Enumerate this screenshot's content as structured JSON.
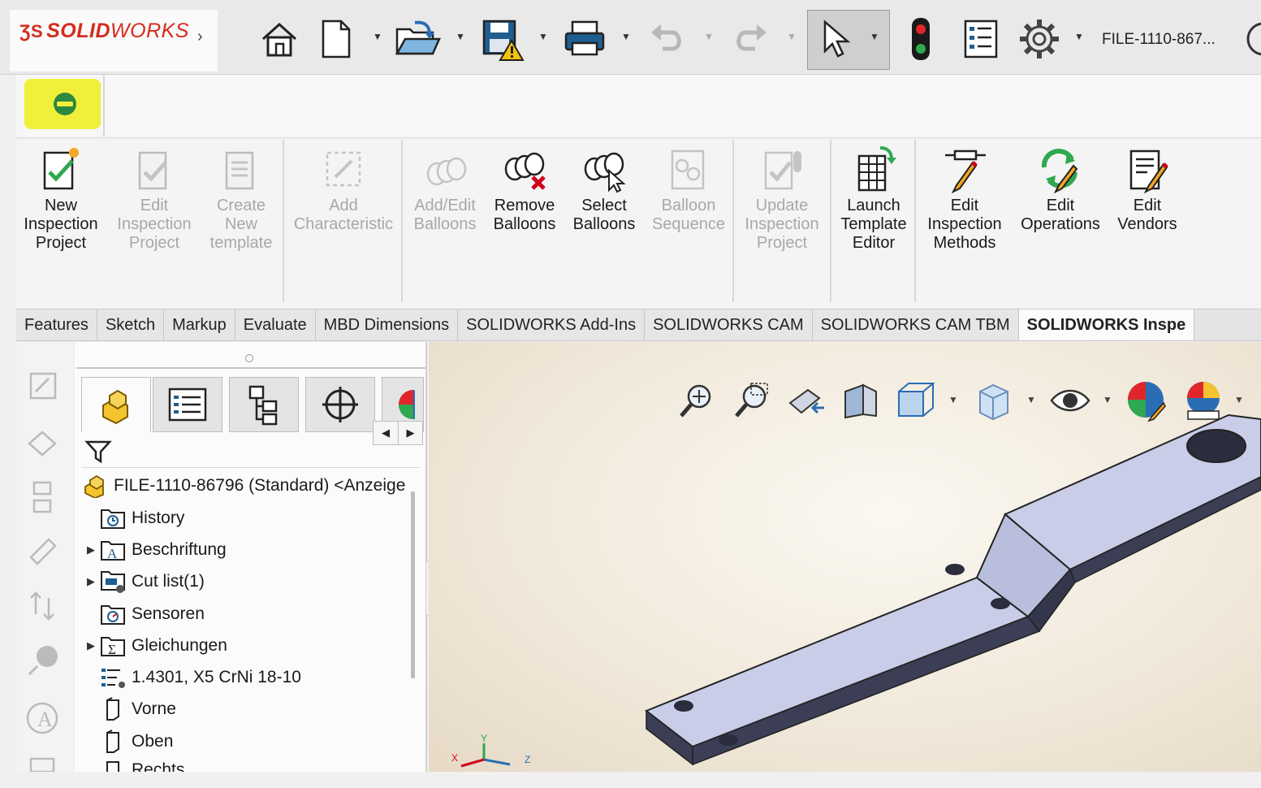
{
  "app": {
    "brand_prefix": "SOLID",
    "brand_suffix": "WORKS",
    "file_title": "FILE-1110-867..."
  },
  "top_toolbar": {
    "icons": [
      "home-icon",
      "new-document-icon",
      "open-icon",
      "save-warning-icon",
      "print-icon",
      "undo-icon",
      "redo-icon",
      "select-pointer-icon",
      "rebuild-traffic-light-icon",
      "file-properties-icon",
      "options-gear-icon",
      "user-icon"
    ]
  },
  "ribbon": {
    "buttons": [
      {
        "label": "New\nInspection\nProject",
        "enabled": true
      },
      {
        "label": "Edit\nInspection\nProject",
        "enabled": false
      },
      {
        "label": "Create\nNew\ntemplate",
        "enabled": false
      },
      {
        "label": "Add\nCharacteristic",
        "enabled": false
      },
      {
        "label": "Add/Edit\nBalloons",
        "enabled": false
      },
      {
        "label": "Remove\nBalloons",
        "enabled": true
      },
      {
        "label": "Select\nBalloons",
        "enabled": true
      },
      {
        "label": "Balloon\nSequence",
        "enabled": false
      },
      {
        "label": "Update\nInspection\nProject",
        "enabled": false
      },
      {
        "label": "Launch\nTemplate\nEditor",
        "enabled": true
      },
      {
        "label": "Edit\nInspection\nMethods",
        "enabled": true
      },
      {
        "label": "Edit\nOperations",
        "enabled": true
      },
      {
        "label": "Edit\nVendors",
        "enabled": true
      }
    ]
  },
  "tabs": [
    "Features",
    "Sketch",
    "Markup",
    "Evaluate",
    "MBD Dimensions",
    "SOLIDWORKS Add-Ins",
    "SOLIDWORKS CAM",
    "SOLIDWORKS CAM TBM",
    "SOLIDWORKS Inspe"
  ],
  "active_tab": "SOLIDWORKS Inspe",
  "tree": {
    "root": "FILE-1110-86796 (Standard) <Anzeige",
    "items": [
      {
        "label": "History",
        "expandable": false,
        "icon": "history-icon"
      },
      {
        "label": "Beschriftung",
        "expandable": true,
        "icon": "annotations-icon"
      },
      {
        "label": "Cut list(1)",
        "expandable": true,
        "icon": "cut-list-icon"
      },
      {
        "label": "Sensoren",
        "expandable": false,
        "icon": "sensors-icon"
      },
      {
        "label": "Gleichungen",
        "expandable": true,
        "icon": "equations-icon"
      },
      {
        "label": "1.4301, X5 CrNi 18-10",
        "expandable": false,
        "icon": "material-icon"
      },
      {
        "label": "Vorne",
        "expandable": false,
        "icon": "plane-icon"
      },
      {
        "label": "Oben",
        "expandable": false,
        "icon": "plane-icon"
      },
      {
        "label": "Rechts",
        "expandable": false,
        "icon": "plane-icon"
      }
    ]
  },
  "colors": {
    "brand_red": "#d52b1e",
    "addin_highlight": "#f0f03a",
    "part_face": "#c9cde8",
    "part_side": "#3b3e55"
  }
}
